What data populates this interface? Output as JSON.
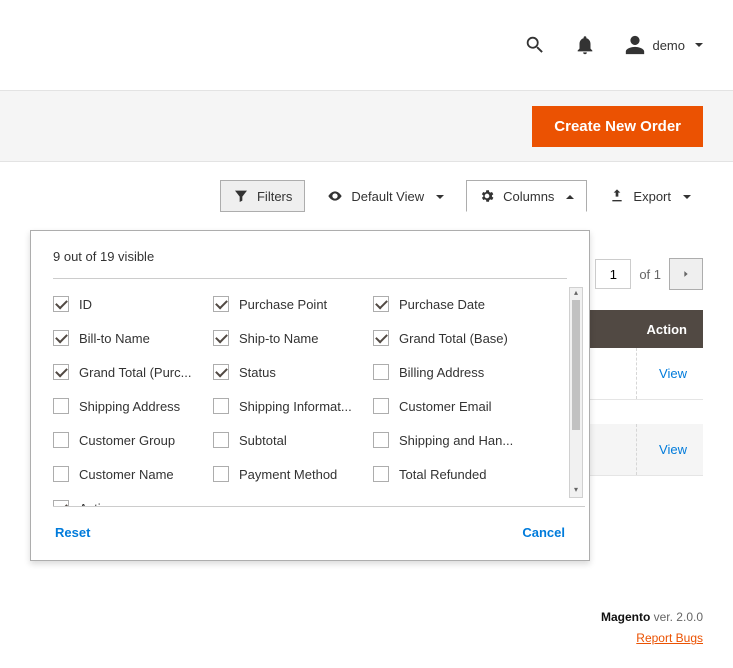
{
  "header": {
    "user_label": "demo"
  },
  "primary_button": "Create New Order",
  "toolbar": {
    "filters": "Filters",
    "view": "Default View",
    "columns": "Columns",
    "export": "Export"
  },
  "pager": {
    "page": "1",
    "of_label": "of 1"
  },
  "grid": {
    "action_header": "Action",
    "rows": [
      {
        "action": "View"
      },
      {
        "action": "View"
      }
    ]
  },
  "columns_panel": {
    "summary": "9 out of 19 visible",
    "reset": "Reset",
    "cancel": "Cancel",
    "items": [
      {
        "label": "ID",
        "checked": true
      },
      {
        "label": "Purchase Point",
        "checked": true
      },
      {
        "label": "Purchase Date",
        "checked": true
      },
      {
        "label": "Bill-to Name",
        "checked": true
      },
      {
        "label": "Ship-to Name",
        "checked": true
      },
      {
        "label": "Grand Total (Base)",
        "checked": true
      },
      {
        "label": "Grand Total (Purc...",
        "checked": true
      },
      {
        "label": "Status",
        "checked": true
      },
      {
        "label": "Billing Address",
        "checked": false
      },
      {
        "label": "Shipping Address",
        "checked": false
      },
      {
        "label": "Shipping Informat...",
        "checked": false
      },
      {
        "label": "Customer Email",
        "checked": false
      },
      {
        "label": "Customer Group",
        "checked": false
      },
      {
        "label": "Subtotal",
        "checked": false
      },
      {
        "label": "Shipping and Han...",
        "checked": false
      },
      {
        "label": "Customer Name",
        "checked": false
      },
      {
        "label": "Payment Method",
        "checked": false
      },
      {
        "label": "Total Refunded",
        "checked": false
      },
      {
        "label": "Action",
        "checked": true
      }
    ]
  },
  "footer": {
    "brand": "Magento",
    "version": " ver. 2.0.0",
    "report": "Report Bugs"
  }
}
